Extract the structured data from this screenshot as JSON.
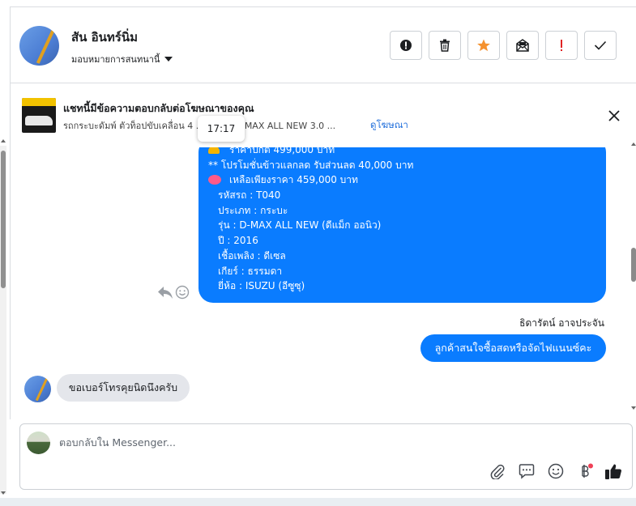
{
  "header": {
    "name": "สัน อินทร์นิ่ม",
    "assign_label": "มอบหมายการสนทนานี้"
  },
  "toolbar": {
    "buttons": [
      {
        "icon": "alert-circle-icon"
      },
      {
        "icon": "trash-icon"
      },
      {
        "icon": "star-icon",
        "color": "#f5922f"
      },
      {
        "icon": "mark-unread-icon"
      },
      {
        "icon": "exclamation-icon",
        "color": "#e02424"
      },
      {
        "icon": "checkmark-icon"
      }
    ]
  },
  "ad_banner": {
    "title": "แชทนี้มีข้อความตอบกลับต่อโฆษณาของคุณ",
    "subtitle": "รถกระบะดัมพ์ ตัวท็อปขับเคลื่อน 4 ...ISUZU D-MAX ALL NEW 3.0 ...",
    "link": "ดูโฆษณา"
  },
  "tooltip": {
    "time": "17:17"
  },
  "messages": {
    "ad_lines": [
      "ราคาปกติ 499,000 บาท",
      "** โปรโมชั่นข้าวแลกลด รับส่วนลด 40,000 บาท",
      "เหลือเพียงราคา 459,000 บาท",
      "รหัสรถ : T040",
      "ประเภท : กระบะ",
      "รุ่น : D-MAX ALL NEW (ดีแม็ก ออนิว)",
      "ปี : 2016",
      "เชื้อเพลิง : ดีเซล",
      "เกียร์ : ธรรมดา",
      "ยี่ห้อ : ISUZU (อีซูซุ)"
    ],
    "sender_name": "ธิดารัตน์ อาจประจัน",
    "outgoing": "ลูกค้าสนใจซื้อสดหรือจัดไฟแนนซ์คะ",
    "incoming": "ขอเบอร์โทรคุยนิดนึงครับ"
  },
  "composer": {
    "placeholder": "ตอบกลับใน Messenger...",
    "icons": [
      "attach-icon",
      "chat-icon",
      "emoji-icon",
      "baht-icon",
      "thumbs-up-icon"
    ],
    "notification_dot_color": "#ef4056",
    "accent": "#0a7cff"
  }
}
